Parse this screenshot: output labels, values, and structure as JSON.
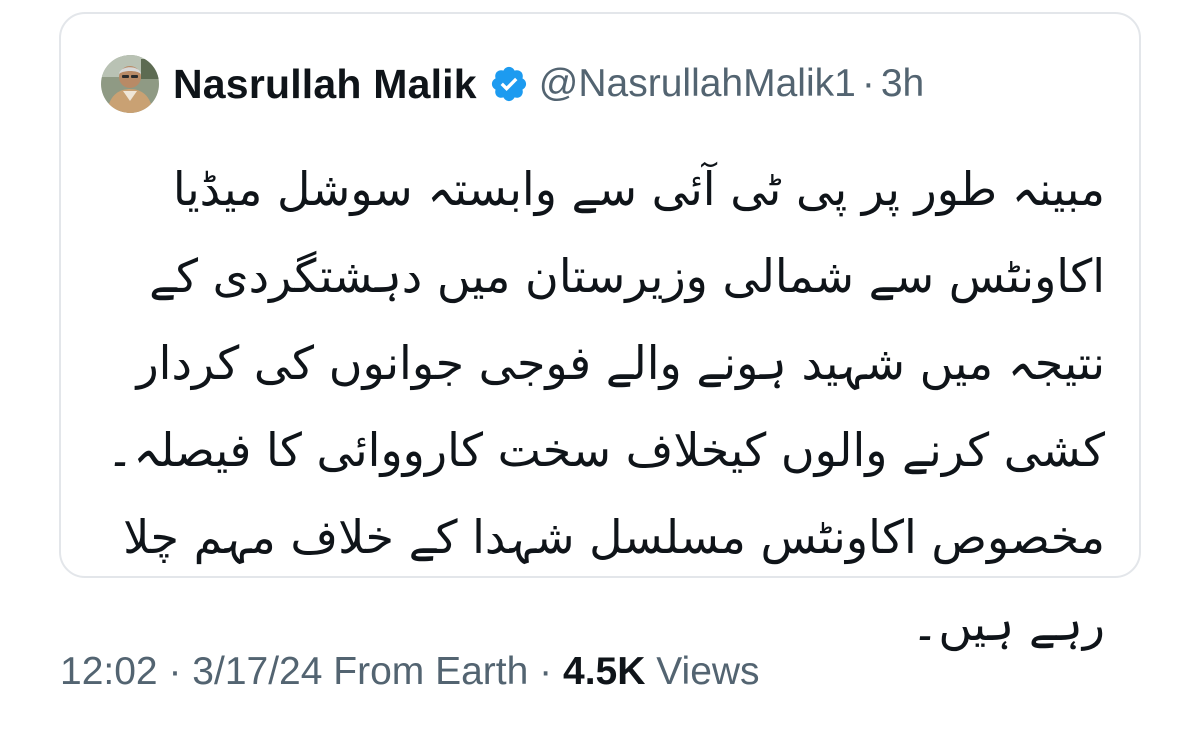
{
  "quoted_post": {
    "author": {
      "display_name": "Nasrullah Malik",
      "handle": "@NasrullahMalik1",
      "verified": true,
      "avatar_icon": "user-photo-avatar"
    },
    "separator": "·",
    "time_ago": "3h",
    "text": "مبینہ طور پر پی ٹی آئی سے وابستہ سوشل میڈیا اکاونٹس سے شمالی وزیرستان میں دہشتگردی کے نتیجہ میں شہید ہونے والے فوجی جوانوں کی کردار کشی کرنے والوں کیخلاف سخت کارووائی کا فیصلہ۔ مخصوص اکاونٹس مسلسل شہدا کے خلاف مہم چلا رہے ہیں۔"
  },
  "post_meta": {
    "time": "12:02",
    "separator": "·",
    "date": "3/17/24",
    "source": "From Earth",
    "views_count": "4.5K",
    "views_label": "Views"
  },
  "colors": {
    "text_primary": "#0f1419",
    "text_secondary": "#536471",
    "verified_blue": "#1d9bf0",
    "card_border": "#e3e6ea"
  }
}
